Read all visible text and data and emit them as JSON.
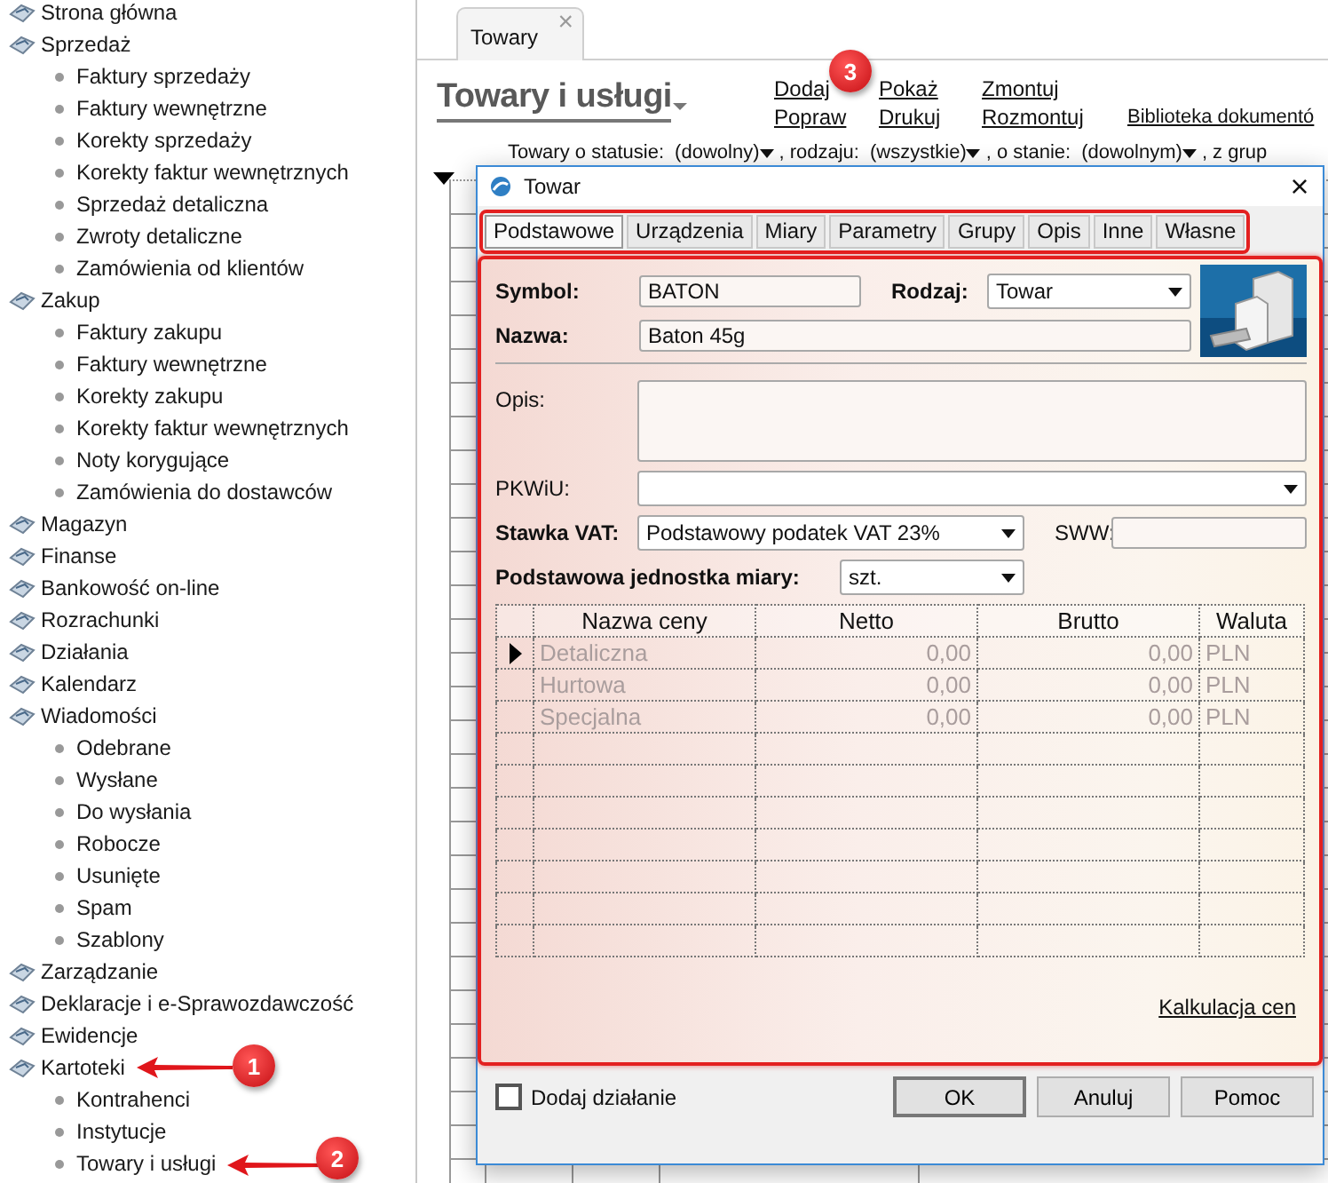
{
  "sidebar": {
    "items": [
      {
        "label": "Strona główna"
      },
      {
        "label": "Sprzedaż",
        "children": [
          {
            "label": "Faktury sprzedaży"
          },
          {
            "label": "Faktury wewnętrzne"
          },
          {
            "label": "Korekty sprzedaży"
          },
          {
            "label": "Korekty faktur wewnętrznych"
          },
          {
            "label": "Sprzedaż detaliczna"
          },
          {
            "label": "Zwroty detaliczne"
          },
          {
            "label": "Zamówienia od klientów"
          }
        ]
      },
      {
        "label": "Zakup",
        "children": [
          {
            "label": "Faktury zakupu"
          },
          {
            "label": "Faktury wewnętrzne"
          },
          {
            "label": "Korekty zakupu"
          },
          {
            "label": "Korekty faktur wewnętrznych"
          },
          {
            "label": "Noty korygujące"
          },
          {
            "label": "Zamówienia do dostawców"
          }
        ]
      },
      {
        "label": "Magazyn"
      },
      {
        "label": "Finanse"
      },
      {
        "label": "Bankowość on-line"
      },
      {
        "label": "Rozrachunki"
      },
      {
        "label": "Działania"
      },
      {
        "label": "Kalendarz"
      },
      {
        "label": "Wiadomości",
        "children": [
          {
            "label": "Odebrane"
          },
          {
            "label": "Wysłane"
          },
          {
            "label": "Do wysłania"
          },
          {
            "label": "Robocze"
          },
          {
            "label": "Usunięte"
          },
          {
            "label": "Spam"
          },
          {
            "label": "Szablony"
          }
        ]
      },
      {
        "label": "Zarządzanie"
      },
      {
        "label": "Deklaracje i e-Sprawozdawczość"
      },
      {
        "label": "Ewidencje"
      },
      {
        "label": "Kartoteki",
        "children": [
          {
            "label": "Kontrahenci"
          },
          {
            "label": "Instytucje"
          },
          {
            "label": "Towary i usługi"
          }
        ]
      }
    ]
  },
  "document_tabs": [
    {
      "label": "Towary",
      "close": "×"
    }
  ],
  "page_title": "Towary i usługi",
  "actions": [
    [
      "Dodaj",
      "Popraw"
    ],
    [
      "Pokaż",
      "Drukuj"
    ],
    [
      "Zmontuj",
      "Rozmontuj"
    ],
    [
      "Biblioteka dokumentó"
    ]
  ],
  "filters": [
    {
      "label": "Towary o statusie:",
      "value": "(dowolny)"
    },
    {
      "label": ", rodzaju:",
      "value": "(wszystkie)"
    },
    {
      "label": ", o stanie:",
      "value": "(dowolnym)"
    },
    {
      "label": ", z grup"
    }
  ],
  "dialog": {
    "title": "Towar",
    "close": "×",
    "tabs": [
      {
        "label": "Podstawowe",
        "selected": true
      },
      {
        "label": "Urządzenia",
        "selected": false
      },
      {
        "label": "Miary",
        "selected": false
      },
      {
        "label": "Parametry",
        "selected": false
      },
      {
        "label": "Grupy",
        "selected": false
      },
      {
        "label": "Opis",
        "selected": false
      },
      {
        "label": "Inne",
        "selected": false
      },
      {
        "label": "Własne",
        "selected": false
      }
    ],
    "symbol": {
      "label": "Symbol:",
      "value": "BATON"
    },
    "rodzaj": {
      "label": "Rodzaj:",
      "value": "Towar"
    },
    "nazwa": {
      "label": "Nazwa:",
      "value": "Baton 45g"
    },
    "opis": {
      "label": "Opis:"
    },
    "pkwiu": {
      "label": "PKWiU:"
    },
    "stawka_vat": {
      "label": "Stawka VAT:",
      "value": "Podstawowy podatek VAT 23%"
    },
    "sww": {
      "label": "SWW:"
    },
    "jednostka": {
      "label": "Podstawowa jednostka miary:",
      "value": "szt."
    },
    "price_table": {
      "columns": [
        "Nazwa ceny",
        "Netto",
        "Brutto",
        "Waluta"
      ],
      "rows": [
        {
          "selected": true,
          "cells": [
            "Detaliczna",
            "0,00",
            "0,00",
            "PLN"
          ]
        },
        {
          "selected": false,
          "cells": [
            "Hurtowa",
            "0,00",
            "0,00",
            "PLN"
          ]
        },
        {
          "selected": false,
          "cells": [
            "Specjalna",
            "0,00",
            "0,00",
            "PLN"
          ]
        }
      ]
    },
    "link": "Kalkulacja cen",
    "checkbox": {
      "label": "Dodaj działanie",
      "checked": false
    },
    "buttons": [
      "OK",
      "Anuluj",
      "Pomoc"
    ]
  },
  "annotations": [
    {
      "label": "1"
    },
    {
      "label": "2"
    },
    {
      "label": "3"
    }
  ]
}
